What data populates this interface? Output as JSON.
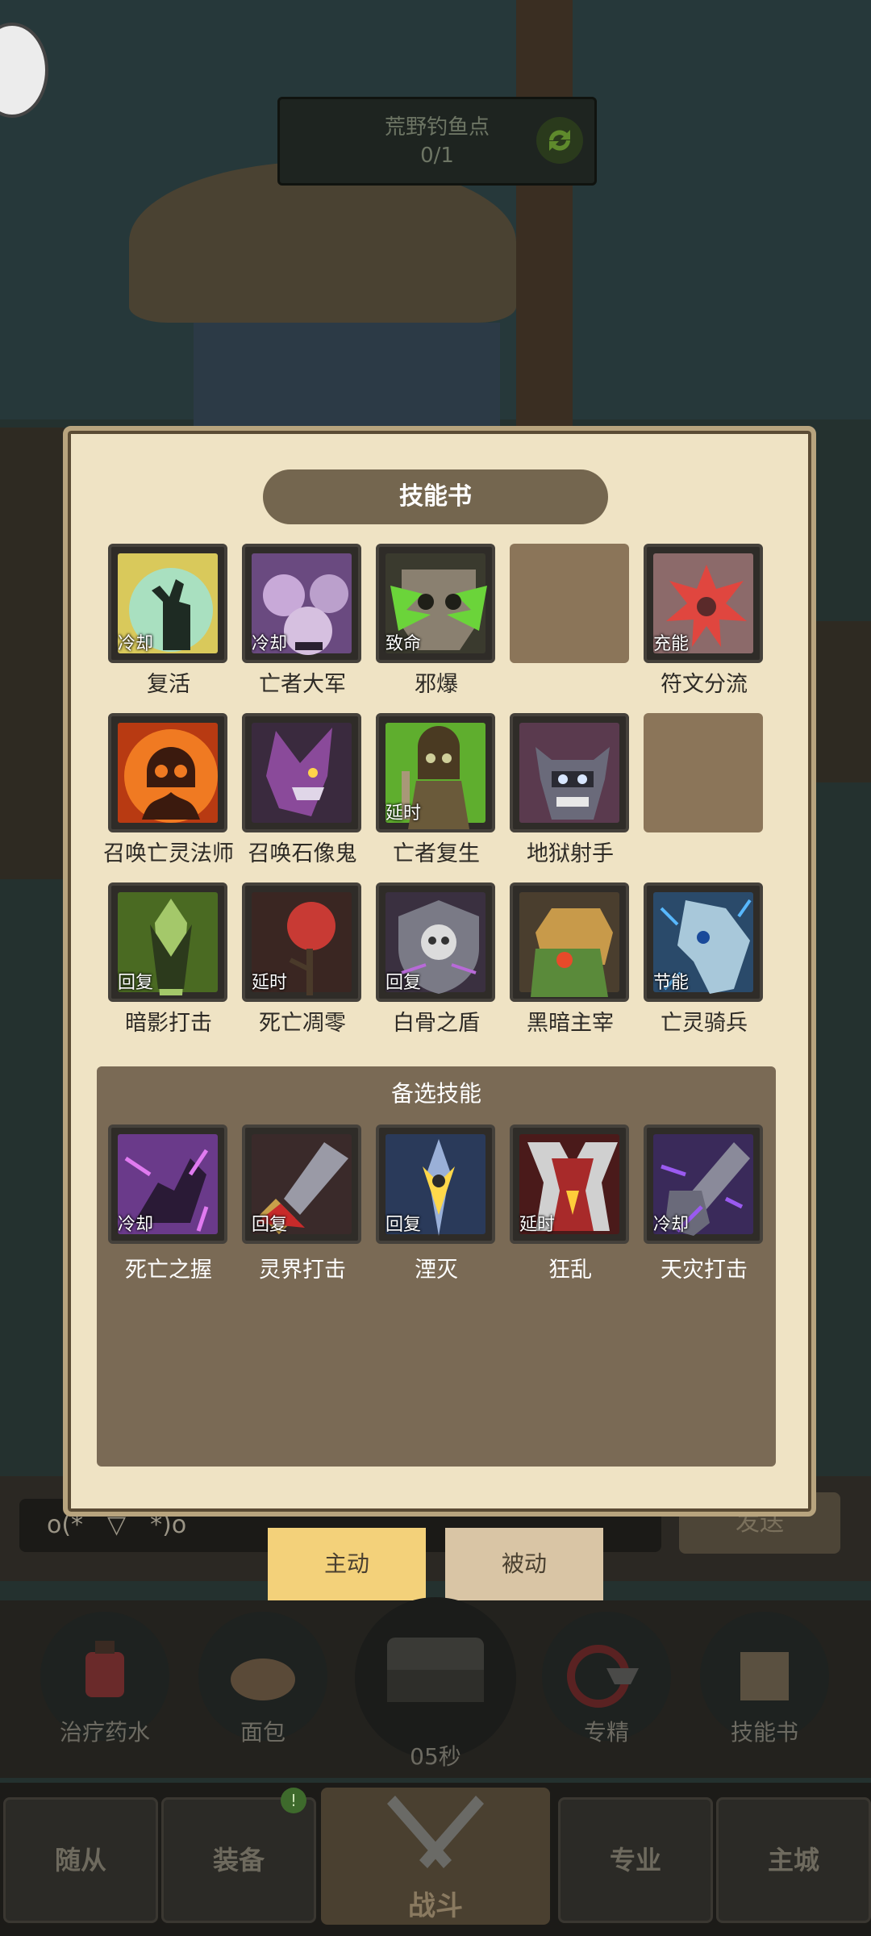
{
  "location": {
    "name": "荒野钓鱼点",
    "progress": "0/1"
  },
  "chat": {
    "emote": "o(*￣▽￣*)o",
    "send_label": "发送"
  },
  "panel": {
    "title": "技能书",
    "row1": [
      {
        "name": "复活",
        "tag": "冷却"
      },
      {
        "name": "亡者大军",
        "tag": "冷却"
      },
      {
        "name": "邪爆",
        "tag": "致命"
      },
      {
        "name": "",
        "tag": ""
      },
      {
        "name": "符文分流",
        "tag": "充能"
      }
    ],
    "row2": [
      {
        "name": "召唤亡灵法师",
        "tag": ""
      },
      {
        "name": "召唤石像鬼",
        "tag": ""
      },
      {
        "name": "亡者复生",
        "tag": "延时"
      },
      {
        "name": "地狱射手",
        "tag": ""
      },
      {
        "name": "",
        "tag": ""
      }
    ],
    "row3": [
      {
        "name": "暗影打击",
        "tag": "回复"
      },
      {
        "name": "死亡凋零",
        "tag": "延时"
      },
      {
        "name": "白骨之盾",
        "tag": "回复"
      },
      {
        "name": "黑暗主宰",
        "tag": ""
      },
      {
        "name": "亡灵骑兵",
        "tag": "节能"
      }
    ],
    "alt_title": "备选技能",
    "alt": [
      {
        "name": "死亡之握",
        "tag": "冷却"
      },
      {
        "name": "灵界打击",
        "tag": "回复"
      },
      {
        "name": "湮灭",
        "tag": "回复"
      },
      {
        "name": "狂乱",
        "tag": "延时"
      },
      {
        "name": "天灾打击",
        "tag": "冷却"
      }
    ]
  },
  "tabs": {
    "active": "主动",
    "passive": "被动"
  },
  "quick": {
    "potion": "治疗药水",
    "bread": "面包",
    "timer": "05秒",
    "spec": "专精",
    "book": "技能书"
  },
  "nav": {
    "follower": "随从",
    "equip": "装备",
    "battle": "战斗",
    "pro": "专业",
    "city": "主城",
    "badge": "!"
  }
}
